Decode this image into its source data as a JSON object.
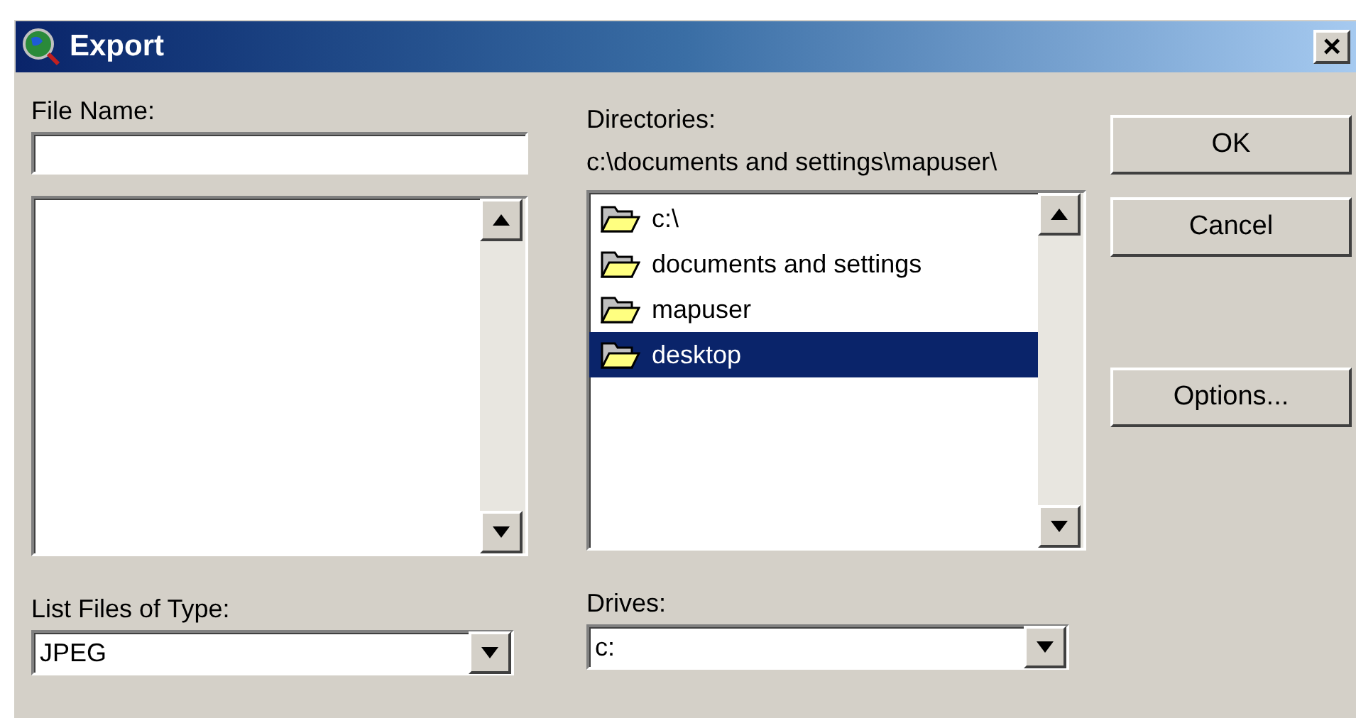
{
  "window": {
    "title": "Export",
    "close": "×"
  },
  "file_name": {
    "label": "File Name:"
  },
  "directories": {
    "label": "Directories:",
    "path": "c:\\documents and settings\\mapuser\\",
    "items": [
      {
        "name": "c:\\",
        "selected": false
      },
      {
        "name": "documents and settings",
        "selected": false
      },
      {
        "name": "mapuser",
        "selected": false
      },
      {
        "name": "desktop",
        "selected": true
      }
    ]
  },
  "file_type": {
    "label": "List Files of Type:",
    "value": "JPEG"
  },
  "drives": {
    "label": "Drives:",
    "value": "c:"
  },
  "buttons": [
    {
      "label": "OK",
      "kind": "primary"
    },
    {
      "label": "Cancel",
      "kind": "primary"
    },
    {
      "label": "Options...",
      "kind": "extra"
    }
  ]
}
